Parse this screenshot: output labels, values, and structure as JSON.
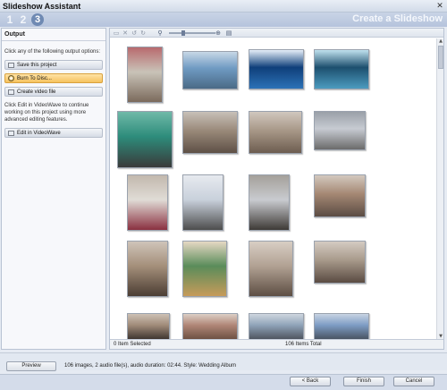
{
  "window": {
    "title": "Slideshow Assistant",
    "close_glyph": "✕"
  },
  "header": {
    "steps": [
      "1",
      "2",
      "3"
    ],
    "title": "Create a Slideshow"
  },
  "output_panel": {
    "heading": "Output",
    "intro": "Click any of the following output options:",
    "buttons": {
      "save": "Save this project",
      "burn": "Burn To Disc...",
      "video": "Create video file"
    },
    "edit_note": "Click Edit in VideoWave to continue working on this project using more advanced editing features.",
    "edit_button": "Edit in VideoWave"
  },
  "toolbar": {
    "icons": [
      "slideshow-icon",
      "delete-icon",
      "rotate-left-icon",
      "rotate-right-icon",
      "zoom-out-icon",
      "zoom-in-icon",
      "view-mode-icon"
    ]
  },
  "gallery": {
    "thumbnails": [
      {
        "colors": [
          "#c9c3b8",
          "#7b6a5c",
          "#b86a6e"
        ]
      },
      {
        "colors": [
          "#6f9ac2",
          "#4a6a86",
          "#c7d7e6"
        ]
      },
      {
        "colors": [
          "#0f3f7a",
          "#2c72b7",
          "#e4eef8"
        ]
      },
      {
        "colors": [
          "#1d4f6e",
          "#4c9bbf",
          "#bfe1ee"
        ]
      },
      {
        "colors": [
          "#2d8c7b",
          "#3a3a3a",
          "#6fb9a8"
        ]
      },
      {
        "colors": [
          "#9a8a7a",
          "#5e5046",
          "#c7c0b8"
        ]
      },
      {
        "colors": [
          "#a89888",
          "#6d5d50",
          "#d0c7be"
        ]
      },
      {
        "colors": [
          "#c7cbd2",
          "#6b6b6b",
          "#9aa0a8"
        ]
      },
      {
        "colors": [
          "#e0dcd6",
          "#8a3040",
          "#c2b8ad"
        ]
      },
      {
        "colors": [
          "#c8d0db",
          "#4d4d4d",
          "#e7eaef"
        ]
      },
      {
        "colors": [
          "#c9cbd0",
          "#3e3a36",
          "#a4a09a"
        ]
      },
      {
        "colors": [
          "#a58874",
          "#5b4c43",
          "#d3c9bf"
        ]
      },
      {
        "colors": [
          "#a48f7a",
          "#4b3d33",
          "#cfc4b9"
        ]
      },
      {
        "colors": [
          "#5a8c5a",
          "#c79b5a",
          "#e6d8c4"
        ]
      },
      {
        "colors": [
          "#b1a193",
          "#5d4e43",
          "#d8cec4"
        ]
      },
      {
        "colors": [
          "#a89a8b",
          "#5a4b42",
          "#d4cbc2"
        ]
      },
      {
        "colors": [
          "#a08b79",
          "#3f3631",
          "#cdc1b5"
        ]
      },
      {
        "colors": [
          "#b08677",
          "#6e5143",
          "#dccfc5"
        ]
      },
      {
        "colors": [
          "#8fa3b8",
          "#4f5660",
          "#cfd6df"
        ]
      },
      {
        "colors": [
          "#7d9cc4",
          "#4a5563",
          "#c8d4e3"
        ]
      }
    ]
  },
  "status": {
    "selected": "0 Item Selected",
    "total": "106 Items Total"
  },
  "bottom": {
    "preview": "Preview",
    "summary": "106 images,  2 audio file(s), audio duration: 02:44.  Style: Wedding Album"
  },
  "footer": {
    "back": "< Back",
    "finish": "Finish",
    "cancel": "Cancel"
  }
}
